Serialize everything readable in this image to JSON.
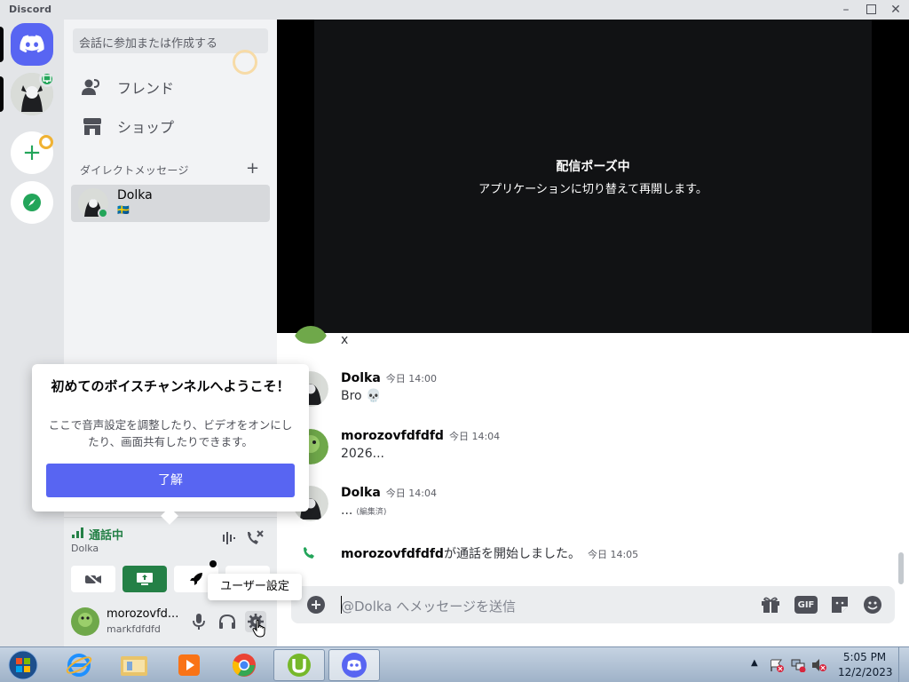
{
  "window": {
    "title": "Discord"
  },
  "sidebar": {
    "search_placeholder": "会話に参加または作成する",
    "nav": [
      {
        "label": "フレンド",
        "icon": "friends-icon"
      },
      {
        "label": "ショップ",
        "icon": "shop-icon"
      }
    ],
    "dm_header": "ダイレクトメッセージ",
    "dm_add": "+",
    "dms": [
      {
        "name": "Dolka",
        "status_flag": "🇸🇪"
      }
    ]
  },
  "voice_panel": {
    "status": "通話中",
    "channel": "Dolka"
  },
  "user_panel": {
    "display_name": "morozovfd...",
    "username": "markfdfdfd"
  },
  "stream": {
    "title": "配信ポーズ中",
    "subtitle": "アプリケーションに切り替えて再開します。"
  },
  "messages": [
    {
      "author": "",
      "time": "",
      "text": "x"
    },
    {
      "author": "Dolka",
      "time": "今日 14:00",
      "text": "Bro 💀"
    },
    {
      "author": "morozovfdfdfd",
      "time": "今日 14:04",
      "text": "2026..."
    },
    {
      "author": "Dolka",
      "time": "今日 14:04",
      "text": "...",
      "edited": "(編集済)"
    }
  ],
  "system_message": {
    "author": "morozovfdfdfd",
    "text": "が通話を開始しました。",
    "time": "今日 14:05"
  },
  "input": {
    "placeholder": "@Dolka へメッセージを送信",
    "gif_label": "GIF"
  },
  "welcome_popup": {
    "title": "初めてのボイスチャンネルへようこそ！",
    "body": "ここで音声設定を調整したり、ビデオをオンにしたり、画面共有したりできます。",
    "button": "了解"
  },
  "tooltip": {
    "settings": "ユーザー設定"
  },
  "taskbar": {
    "time": "5:05 PM",
    "date": "12/2/2023"
  },
  "colors": {
    "accent": "#5865f2",
    "voice_green": "#248046",
    "online": "#23a55a"
  }
}
